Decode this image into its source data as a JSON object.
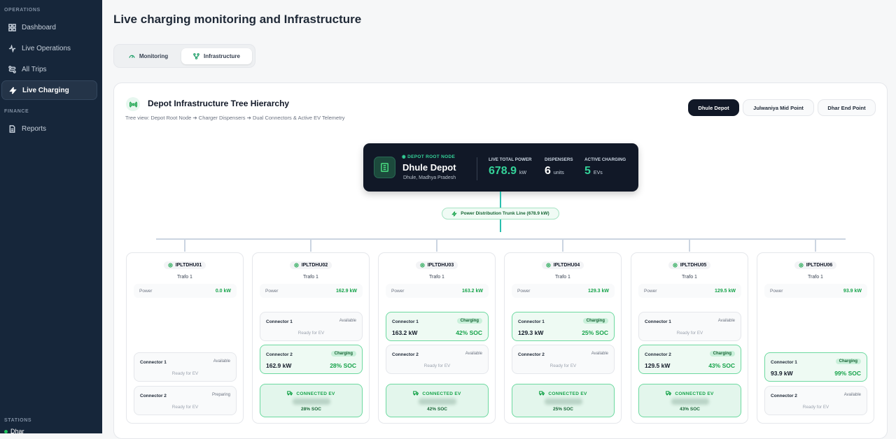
{
  "sidebar": {
    "section_operations": "OPERATIONS",
    "items": [
      {
        "label": "Dashboard"
      },
      {
        "label": "Live Operations"
      },
      {
        "label": "All Trips"
      },
      {
        "label": "Live Charging"
      }
    ],
    "section_finance": "FINANCE",
    "finance_items": [
      {
        "label": "Reports"
      }
    ],
    "section_stations": "STATIONS",
    "station": "Dhar"
  },
  "page_title": "Live charging monitoring and Infrastructure",
  "tabs": [
    {
      "label": "Monitoring"
    },
    {
      "label": "Infrastructure"
    }
  ],
  "panel": {
    "title": "Depot Infrastructure Tree Hierarchy",
    "subtitle": "Tree view: Depot Root Node ➔ Charger Dispensers ➔ Dual Connectors & Active EV Telemetry",
    "depots": [
      {
        "label": "Dhule Depot"
      },
      {
        "label": "Julwaniya Mid Point"
      },
      {
        "label": "Dhar End Point"
      }
    ]
  },
  "root": {
    "tag": "DEPOT ROOT NODE",
    "name": "Dhule Depot",
    "location": "Dhule, Madhya Pradesh",
    "power_label": "LIVE TOTAL POWER",
    "power_value": "678.9",
    "power_unit": "kW",
    "disp_label": "DISPENSERS",
    "disp_value": "6",
    "disp_unit": "units",
    "active_label": "ACTIVE CHARGING",
    "active_value": "5",
    "active_unit": "EVs"
  },
  "trunk": "Power Distribution Trunk Line (678.9 kW)",
  "colors": {
    "accent": "#16a34a",
    "sidebar": "#16263a",
    "dark_card": "#111827"
  },
  "dispensers": [
    {
      "id": "IPLTDHU01",
      "trafo": "Trafo 1",
      "power_label": "Power",
      "power": "0.0 kW",
      "c1": {
        "name": "Connector 1",
        "status": "Available",
        "ready": "Ready for EV"
      },
      "c2": {
        "name": "Connector 2",
        "status": "Preparing",
        "ready": "Ready for EV"
      }
    },
    {
      "id": "IPLTDHU02",
      "trafo": "Trafo 1",
      "power_label": "Power",
      "power": "162.9 kW",
      "c1": {
        "name": "Connector 1",
        "status": "Available",
        "ready": "Ready for EV"
      },
      "c2": {
        "name": "Connector 2",
        "status": "Charging",
        "kw": "162.9 kW",
        "soc": "28% SOC"
      },
      "ev": {
        "label": "CONNECTED EV",
        "soc": "28% SOC"
      }
    },
    {
      "id": "IPLTDHU03",
      "trafo": "Trafo 1",
      "power_label": "Power",
      "power": "163.2 kW",
      "c1": {
        "name": "Connector 1",
        "status": "Charging",
        "kw": "163.2 kW",
        "soc": "42% SOC"
      },
      "c2": {
        "name": "Connector 2",
        "status": "Available",
        "ready": "Ready for EV"
      },
      "ev": {
        "label": "CONNECTED EV",
        "soc": "42% SOC"
      }
    },
    {
      "id": "IPLTDHU04",
      "trafo": "Trafo 1",
      "power_label": "Power",
      "power": "129.3 kW",
      "c1": {
        "name": "Connector 1",
        "status": "Charging",
        "kw": "129.3 kW",
        "soc": "25% SOC"
      },
      "c2": {
        "name": "Connector 2",
        "status": "Available",
        "ready": "Ready for EV"
      },
      "ev": {
        "label": "CONNECTED EV",
        "soc": "25% SOC"
      }
    },
    {
      "id": "IPLTDHU05",
      "trafo": "Trafo 1",
      "power_label": "Power",
      "power": "129.5 kW",
      "c1": {
        "name": "Connector 1",
        "status": "Available",
        "ready": "Ready for EV"
      },
      "c2": {
        "name": "Connector 2",
        "status": "Charging",
        "kw": "129.5 kW",
        "soc": "43% SOC"
      },
      "ev": {
        "label": "CONNECTED EV",
        "soc": "43% SOC"
      }
    },
    {
      "id": "IPLTDHU06",
      "trafo": "Trafo 1",
      "power_label": "Power",
      "power": "93.9 kW",
      "c1": {
        "name": "Connector 1",
        "status": "Charging",
        "kw": "93.9 kW",
        "soc": "99% SOC"
      },
      "c2": {
        "name": "Connector 2",
        "status": "Available",
        "ready": "Ready for EV"
      }
    }
  ]
}
